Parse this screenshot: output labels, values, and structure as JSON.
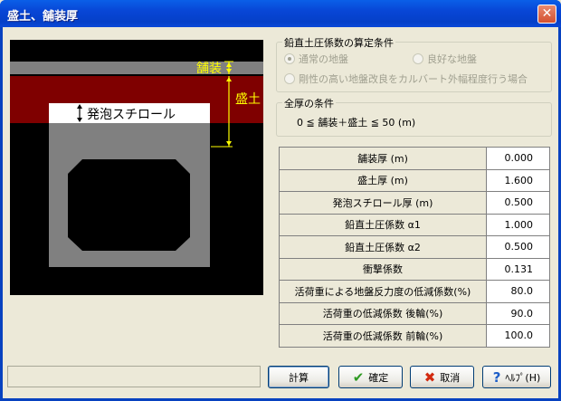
{
  "window": {
    "title": "盛土、舗装厚",
    "close_symbol": "✕"
  },
  "diagram": {
    "pavement_label": "舗装",
    "fill_label": "盛土",
    "styrofoam_label": "発泡スチロール",
    "colors": {
      "fill": "#7F0000",
      "pavement": "#808080",
      "culvert": "#808080",
      "dimension": "#FFFF00"
    }
  },
  "earth_pressure_group": {
    "title": "鉛直土圧係数の算定条件",
    "options": [
      {
        "label": "通常の地盤",
        "checked": true
      },
      {
        "label": "良好な地盤",
        "checked": false
      },
      {
        "label": "剛性の高い地盤改良をカルバート外幅程度行う場合",
        "checked": false
      }
    ]
  },
  "thickness_group": {
    "title": "全厚の条件",
    "condition": "0 ≦ 舗装＋盛土 ≦ 50 (m)"
  },
  "table": {
    "rows": [
      {
        "label": "舗装厚 (m)",
        "value": "0.000"
      },
      {
        "label": "盛土厚 (m)",
        "value": "1.600"
      },
      {
        "label": "発泡スチロール厚 (m)",
        "value": "0.500"
      },
      {
        "label": "鉛直土圧係数 α1",
        "value": "1.000"
      },
      {
        "label": "鉛直土圧係数 α2",
        "value": "0.500"
      },
      {
        "label": "衝撃係数",
        "value": "0.131"
      },
      {
        "label": "活荷重による地盤反力度の低減係数(%)",
        "value": "80.0"
      },
      {
        "label": "活荷重の低減係数 後輪(%)",
        "value": "90.0"
      },
      {
        "label": "活荷重の低減係数 前輪(%)",
        "value": "100.0"
      }
    ]
  },
  "buttons": {
    "calc": "計算",
    "ok": "確定",
    "cancel": "取消",
    "help": "ﾍﾙﾌﾟ(H)"
  }
}
